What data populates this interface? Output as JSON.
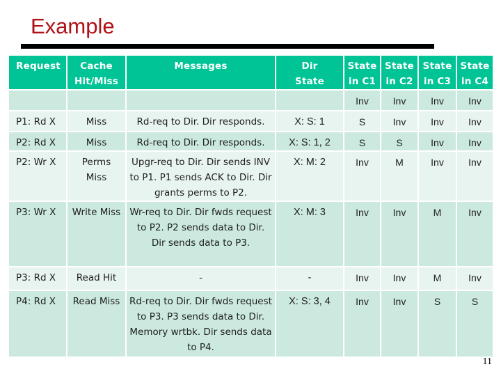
{
  "slide": {
    "title": "Example",
    "page_number": "11"
  },
  "table": {
    "headers": {
      "request": "Request",
      "cache_line1": "Cache",
      "cache_line2": "Hit/Miss",
      "messages": "Messages",
      "dir_line1": "Dir",
      "dir_line2": "State",
      "c1_line1": "State",
      "c1_line2": "in C1",
      "c2_line1": "State",
      "c2_line2": "in C2",
      "c3_line1": "State",
      "c3_line2": "in C3",
      "c4_line1": "State",
      "c4_line2": "in C4"
    },
    "rows": [
      {
        "request": "",
        "cache": "",
        "messages": "",
        "dir": "",
        "c1": "Inv",
        "c2": "Inv",
        "c3": "Inv",
        "c4": "Inv"
      },
      {
        "request": "P1: Rd X",
        "cache": "Miss",
        "messages": "Rd-req to Dir. Dir responds.",
        "dir": "X: S: 1",
        "c1": "S",
        "c2": "Inv",
        "c3": "Inv",
        "c4": "Inv"
      },
      {
        "request": "P2: Rd X",
        "cache": "Miss",
        "messages": "Rd-req to Dir. Dir responds.",
        "dir": "X: S: 1, 2",
        "c1": "S",
        "c2": "S",
        "c3": "Inv",
        "c4": "Inv"
      },
      {
        "request": "P2: Wr X",
        "cache": "Perms Miss",
        "messages": "Upgr-req to Dir. Dir sends INV to P1. P1 sends ACK to Dir. Dir grants perms to P2.",
        "dir": "X: M: 2",
        "c1": "Inv",
        "c2": "M",
        "c3": "Inv",
        "c4": "Inv"
      },
      {
        "request": "P3: Wr X",
        "cache": "Write Miss",
        "messages": "Wr-req to Dir. Dir fwds request to P2. P2 sends data to Dir. Dir sends data to P3.",
        "dir": "X: M: 3",
        "c1": "Inv",
        "c2": "Inv",
        "c3": "M",
        "c4": "Inv"
      },
      {
        "request": "P3: Rd X",
        "cache": "Read Hit",
        "messages": "-",
        "dir": "-",
        "c1": "Inv",
        "c2": "Inv",
        "c3": "M",
        "c4": "Inv"
      },
      {
        "request": "P4: Rd X",
        "cache": "Read Miss",
        "messages": "Rd-req to Dir. Dir fwds request to P3. P3 sends data to Dir. Memory wrtbk. Dir sends data to P4.",
        "dir": "X: S: 3, 4",
        "c1": "Inv",
        "c2": "Inv",
        "c3": "S",
        "c4": "S"
      }
    ]
  }
}
